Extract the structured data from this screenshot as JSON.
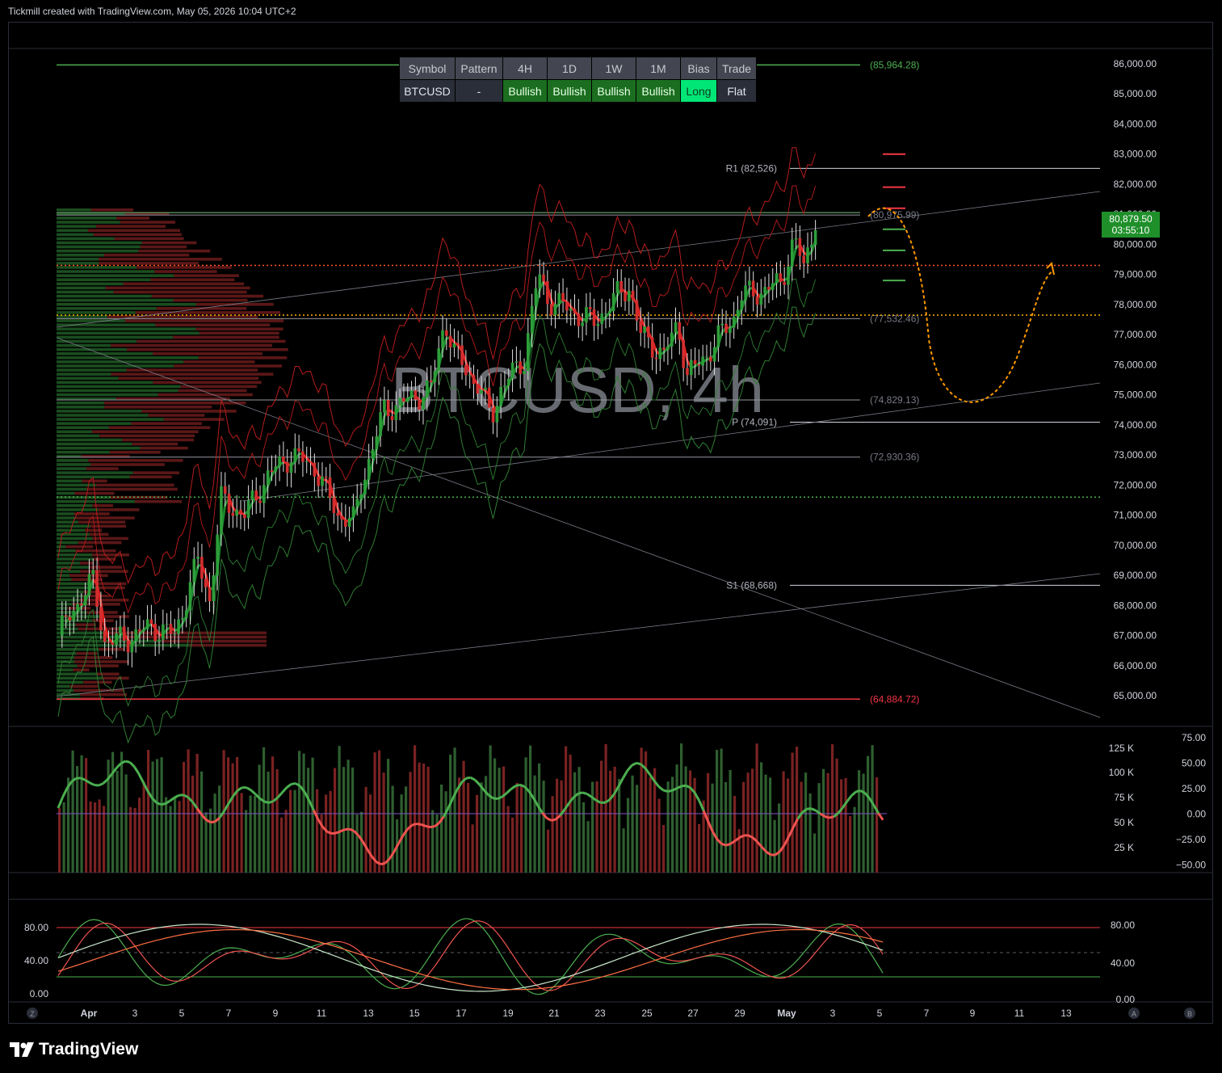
{
  "header": {
    "attribution": "Tickmill created with TradingView.com, May 05, 2026 10:04 UTC+2"
  },
  "footer": {
    "brand": "TradingView"
  },
  "watermark": {
    "text": "BTCUSD, 4h"
  },
  "signal_table": {
    "headers": [
      "Symbol",
      "Pattern",
      "4H",
      "1D",
      "1W",
      "1M",
      "Bias",
      "Trade"
    ],
    "values": [
      "BTCUSD",
      "-",
      "Bullish",
      "Bullish",
      "Bullish",
      "Bullish",
      "Long",
      "Flat"
    ]
  },
  "current_price": {
    "price": "80,879.50",
    "countdown": "03:55:10"
  },
  "colors": {
    "bull": "#2e9e3a",
    "bear": "#d32f2f",
    "level_green": "#4caf50",
    "level_red": "#f23645",
    "dotted_red": "#ff5722",
    "dotted_orange": "#ffb300",
    "forecast": "#ff9800"
  },
  "chart_data": [
    {
      "type": "candlestick",
      "title": "",
      "symbol": "BTCUSD",
      "interval": "4h",
      "ylim": [
        64500,
        86500
      ],
      "y_ticks": [
        "86,000.00",
        "85,000.00",
        "84,000.00",
        "83,000.00",
        "82,000.00",
        "81,000.00",
        "80,000.00",
        "79,000.00",
        "78,000.00",
        "77,000.00",
        "76,000.00",
        "75,000.00",
        "74,000.00",
        "73,000.00",
        "72,000.00",
        "71,000.00",
        "70,000.00",
        "69,000.00",
        "68,000.00",
        "67,000.00",
        "66,000.00",
        "65,000.00"
      ],
      "x_ticks": [
        "Apr",
        "3",
        "5",
        "7",
        "9",
        "11",
        "13",
        "15",
        "17",
        "19",
        "21",
        "23",
        "25",
        "27",
        "29",
        "May",
        "3",
        "5",
        "7",
        "9",
        "11",
        "13"
      ],
      "price_path": [
        {
          "day": 0,
          "close": 67000
        },
        {
          "day": 1,
          "close": 68300
        },
        {
          "day": 1.5,
          "close": 68800
        },
        {
          "day": 2,
          "close": 66800
        },
        {
          "day": 3,
          "close": 66900
        },
        {
          "day": 4,
          "close": 67300
        },
        {
          "day": 5,
          "close": 67000
        },
        {
          "day": 6,
          "close": 69500
        },
        {
          "day": 6.5,
          "close": 68200
        },
        {
          "day": 7,
          "close": 71500
        },
        {
          "day": 8,
          "close": 71000
        },
        {
          "day": 9,
          "close": 72300
        },
        {
          "day": 10,
          "close": 73000
        },
        {
          "day": 11,
          "close": 72600
        },
        {
          "day": 12,
          "close": 71000
        },
        {
          "day": 12.7,
          "close": 70800
        },
        {
          "day": 13,
          "close": 72000
        },
        {
          "day": 14,
          "close": 74500
        },
        {
          "day": 15,
          "close": 74800
        },
        {
          "day": 16,
          "close": 75200
        },
        {
          "day": 16.6,
          "close": 77500
        },
        {
          "day": 17,
          "close": 76400
        },
        {
          "day": 18,
          "close": 75300
        },
        {
          "day": 18.6,
          "close": 74300
        },
        {
          "day": 19,
          "close": 75200
        },
        {
          "day": 20,
          "close": 76200
        },
        {
          "day": 20.6,
          "close": 79000
        },
        {
          "day": 21,
          "close": 78200
        },
        {
          "day": 22,
          "close": 77800
        },
        {
          "day": 23,
          "close": 77400
        },
        {
          "day": 24,
          "close": 78300
        },
        {
          "day": 24.5,
          "close": 78600
        },
        {
          "day": 25,
          "close": 77000
        },
        {
          "day": 26,
          "close": 76300
        },
        {
          "day": 26.6,
          "close": 77400
        },
        {
          "day": 27,
          "close": 75600
        },
        {
          "day": 28,
          "close": 76500
        },
        {
          "day": 29,
          "close": 77600
        },
        {
          "day": 29.3,
          "close": 78300
        },
        {
          "day": 30,
          "close": 78400
        },
        {
          "day": 31,
          "close": 78700
        },
        {
          "day": 31.6,
          "close": 80200
        },
        {
          "day": 32,
          "close": 79200
        },
        {
          "day": 32.5,
          "close": 80880
        }
      ],
      "horizontal_levels": [
        {
          "label": "(85,964.28)",
          "value": 85964.28,
          "color": "#4caf50"
        },
        {
          "label": "R1 (82,526)",
          "value": 82526
        },
        {
          "label": "(80,975.99)",
          "value": 80975.99
        },
        {
          "label": "(77,532.46)",
          "value": 77532.46
        },
        {
          "label": "(74,829.13)",
          "value": 74829.13
        },
        {
          "label": "P (74,091)",
          "value": 74091
        },
        {
          "label": "(72,930.36)",
          "value": 72930.36
        },
        {
          "label": "S1 (68,668)",
          "value": 68668
        },
        {
          "label": "(64,884.72)",
          "value": 64884.72,
          "color": "#f23645"
        }
      ],
      "dotted_levels": [
        79300,
        77650,
        71600
      ]
    },
    {
      "type": "oscillator",
      "left_ticks": [
        "125 K",
        "100 K",
        "75 K",
        "50 K",
        "25 K"
      ],
      "right_ticks": [
        "75.00",
        "50.00",
        "25.00",
        "0.00",
        "−25.00",
        "−50.00"
      ]
    },
    {
      "type": "stochastic",
      "left_ticks": [
        "80.00",
        "40.00",
        "0.00"
      ],
      "right_ticks": [
        "80.00",
        "40.00",
        "0.00"
      ]
    }
  ]
}
